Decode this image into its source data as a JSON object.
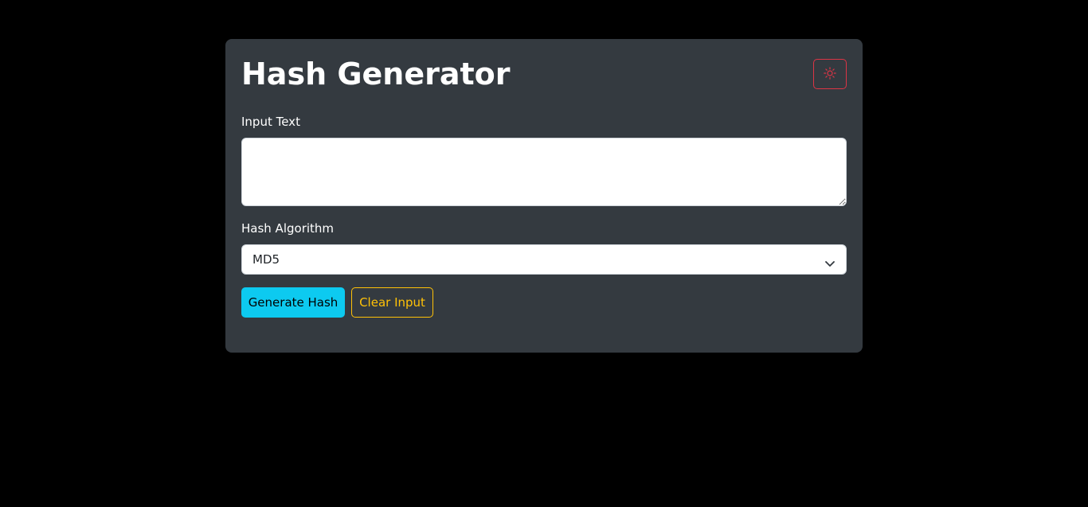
{
  "page": {
    "title": "Hash Generator"
  },
  "theme_toggle": {
    "icon": "sun-icon",
    "color": "#dc3545"
  },
  "form": {
    "input_label": "Input Text",
    "input_value": "",
    "algorithm_label": "Hash Algorithm",
    "algorithm_selected": "MD5"
  },
  "buttons": {
    "generate_label": "Generate Hash",
    "clear_label": "Clear Input"
  },
  "colors": {
    "background": "#000000",
    "card": "#343a40",
    "generate": "#0dcaf0",
    "clear": "#ffc107",
    "toggle": "#dc3545"
  }
}
